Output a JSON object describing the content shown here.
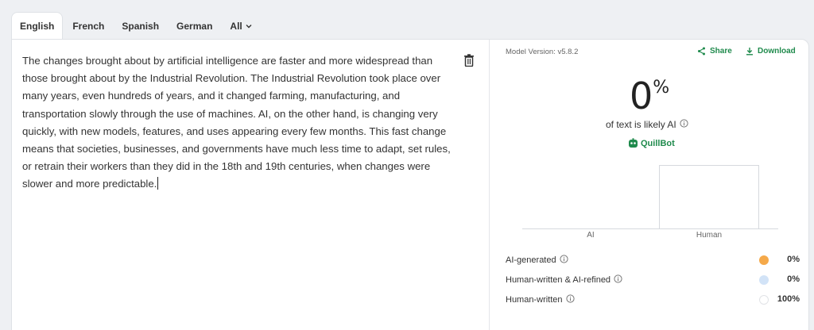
{
  "tabs": [
    {
      "label": "English",
      "active": true
    },
    {
      "label": "French",
      "active": false
    },
    {
      "label": "Spanish",
      "active": false
    },
    {
      "label": "German",
      "active": false
    },
    {
      "label": "All",
      "active": false
    }
  ],
  "editor": {
    "text": "The changes brought about by artificial intelligence are faster and more widespread than those brought about by the Industrial Revolution. The Industrial Revolution took place over many years, even hundreds of years, and it changed farming, manufacturing, and transportation slowly through the use of machines. AI, on the other hand, is changing very quickly, with new models, features, and uses appearing every few months. This fast change means that societies, businesses, and governments have much less time to adapt, set rules, or retrain their workers than they did in the 18th and 19th centuries, when changes were slower and more predictable."
  },
  "results": {
    "model_version": "Model Version: v5.8.2",
    "share_label": "Share",
    "download_label": "Download",
    "score": "0",
    "score_unit": "%",
    "likely_label": "of text is likely AI",
    "brand": "QuillBot",
    "accent": "#1f8a4c"
  },
  "chart_data": {
    "type": "bar",
    "categories": [
      "AI",
      "Human"
    ],
    "values": [
      0,
      100
    ],
    "ylim": [
      0,
      100
    ],
    "grid": false
  },
  "legend": [
    {
      "label": "AI-generated",
      "value": "0%",
      "color": "#f5a94a"
    },
    {
      "label": "Human-written & AI-refined",
      "value": "0%",
      "color": "#d2e3f7"
    },
    {
      "label": "Human-written",
      "value": "100%",
      "color": "#ffffff"
    }
  ]
}
